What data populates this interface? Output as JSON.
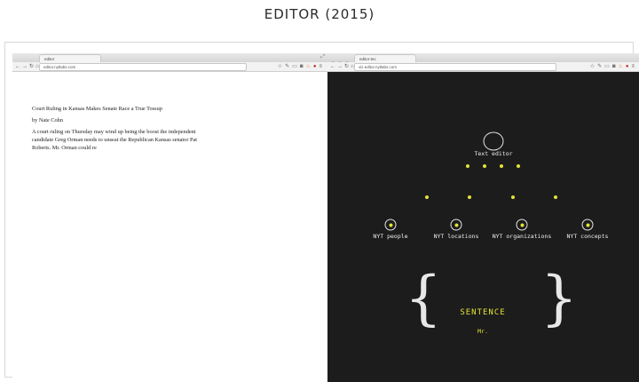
{
  "page_title": "EDITOR (2015)",
  "left_window": {
    "tab_title": "editor",
    "url": "editor.nytlabs.com",
    "nav_icons": [
      "back-icon",
      "forward-icon",
      "reload-icon",
      "home-icon"
    ],
    "article": {
      "headline": "Court Ruling in Kansas Makes Senate Race a True Tossup",
      "byline": "by Nate Cohn",
      "body": "A court ruling on Thursday may wind up being the boost the independent candidate Greg Orman needs to unseat the Republican Kansas senator Pat Roberts. Mr. Orman could re"
    }
  },
  "right_window": {
    "tab_title": "editor-tec",
    "url": "viz.editor.nytlabs.com",
    "visualization": {
      "root_label": "Text editor",
      "categories": [
        "NYT people",
        "NYT locations",
        "NYT organizations",
        "NYT concepts"
      ],
      "sentence_title": "SENTENCE",
      "sentence_word": "Mr."
    }
  },
  "colors": {
    "viz_background": "#1c1c1c",
    "accent_yellow": "#e3e334",
    "mac_red": "#ec5f57",
    "mac_yellow": "#f4bd4f",
    "mac_green": "#5fc453"
  }
}
